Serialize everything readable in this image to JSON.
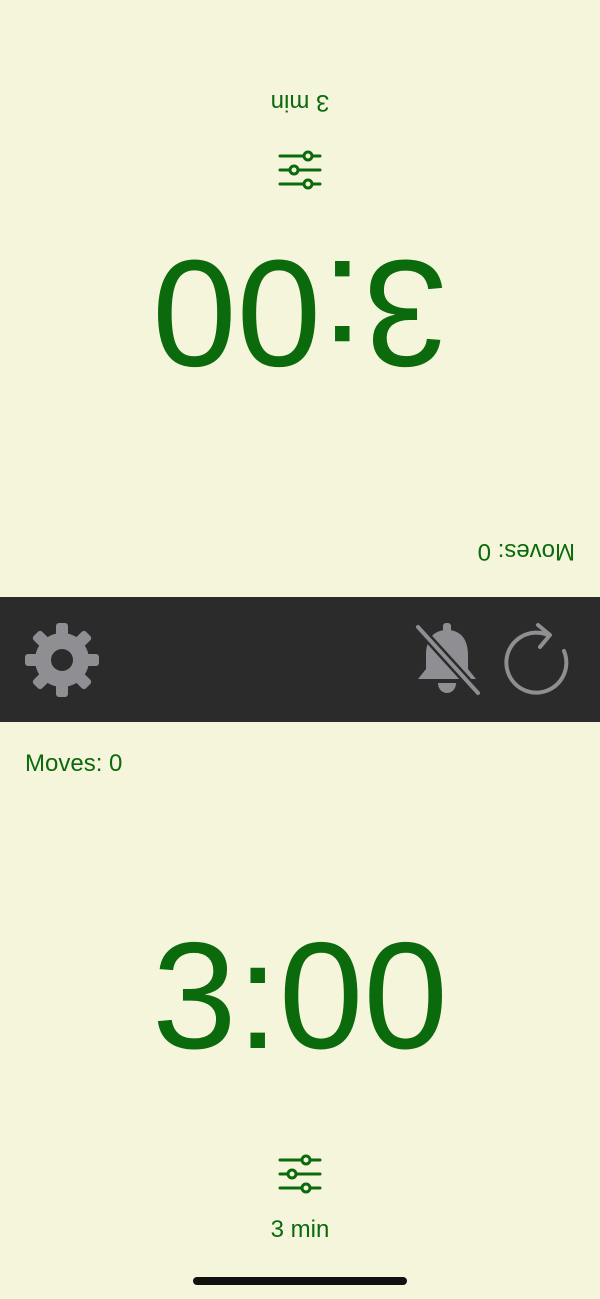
{
  "colors": {
    "background": "#F5F5DC",
    "accent": "#0B6A0B",
    "toolbar": "#2B2B2B",
    "toolbar_icon": "#8E8E93"
  },
  "top_player": {
    "moves": "Moves: 0",
    "time": "3:00",
    "preset_icon": "sliders-icon",
    "preset_label": "3 min"
  },
  "bottom_player": {
    "moves": "Moves: 0",
    "time": "3:00",
    "preset_icon": "sliders-icon",
    "preset_label": "3 min"
  },
  "toolbar": {
    "settings_icon": "gear-icon",
    "mute_icon": "bell-slash-icon",
    "reset_icon": "reset-icon"
  }
}
